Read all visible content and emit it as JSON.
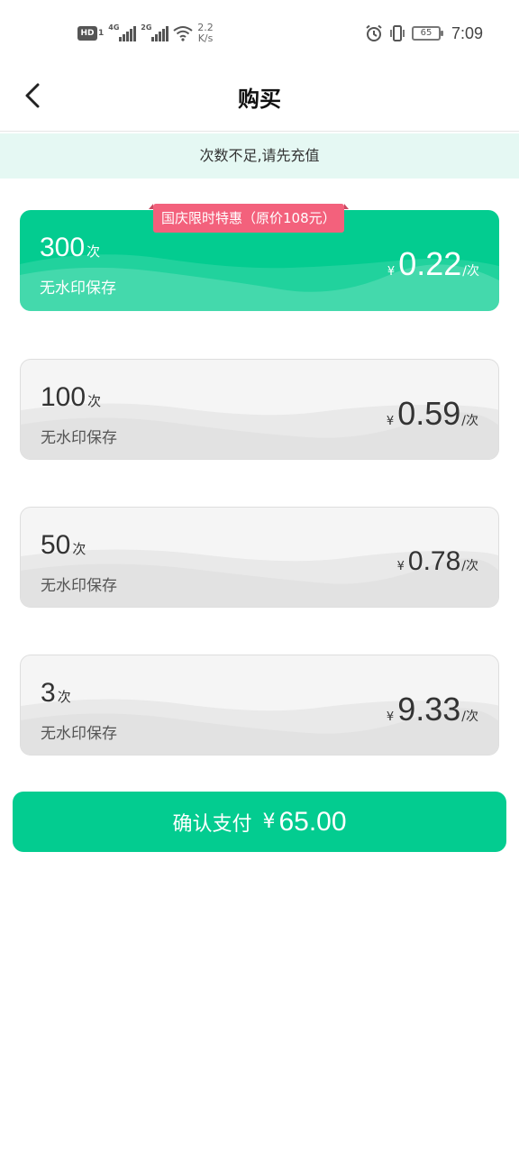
{
  "status_bar": {
    "hd_label": "HD",
    "hd_sub": "1",
    "sig1_tag": "4G",
    "sig2_tag": "2G",
    "speed_value": "2.2",
    "speed_unit": "K/s",
    "battery": "65",
    "time": "7:09"
  },
  "header": {
    "title": "购买"
  },
  "notice": {
    "text": "次数不足,请先充值"
  },
  "promo": {
    "text": "国庆限时特惠（原价108元）"
  },
  "packages": [
    {
      "count": "300",
      "unit": "次",
      "desc": "无水印保存",
      "currency": "¥",
      "price": "0.22",
      "per": "/次",
      "selected": true
    },
    {
      "count": "100",
      "unit": "次",
      "desc": "无水印保存",
      "currency": "¥",
      "price": "0.59",
      "per": "/次",
      "selected": false
    },
    {
      "count": "50",
      "unit": "次",
      "desc": "无水印保存",
      "currency": "¥",
      "price": "0.78",
      "per": "/次",
      "selected": false
    },
    {
      "count": "3",
      "unit": "次",
      "desc": "无水印保存",
      "currency": "¥",
      "price": "9.33",
      "per": "/次",
      "selected": false
    }
  ],
  "pay_button": {
    "label": "确认支付",
    "currency": "¥",
    "amount": "65.00"
  },
  "colors": {
    "accent": "#03cc90",
    "promo": "#f3617c",
    "notice_bg": "#e5f8f3"
  }
}
